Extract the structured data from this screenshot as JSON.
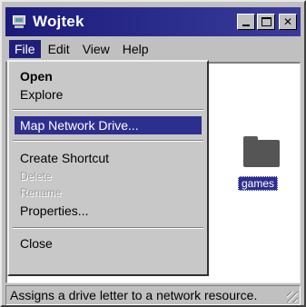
{
  "window": {
    "title": "Wojtek"
  },
  "menubar": {
    "items": [
      "File",
      "Edit",
      "View",
      "Help"
    ]
  },
  "file_menu": {
    "items": [
      {
        "label": "Open",
        "style": "bold"
      },
      {
        "label": "Explore",
        "style": "normal"
      },
      {
        "label": "Map Network Drive...",
        "style": "selected"
      },
      {
        "label": "Create Shortcut",
        "style": "normal"
      },
      {
        "label": "Delete",
        "style": "disabled"
      },
      {
        "label": "Rename",
        "style": "disabled"
      },
      {
        "label": "Properties...",
        "style": "normal"
      },
      {
        "label": "Close",
        "style": "normal"
      }
    ]
  },
  "content": {
    "folder_label": "games"
  },
  "statusbar": {
    "text": "Assigns a drive letter to a network resource."
  },
  "colors": {
    "titlebar": "#2d2f8f",
    "selection": "#2d2f8f",
    "face": "#c0c0c0"
  }
}
